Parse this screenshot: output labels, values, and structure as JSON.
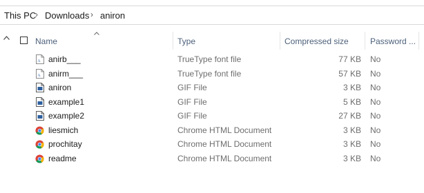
{
  "breadcrumb": {
    "items": [
      "This PC",
      "Downloads",
      "aniron"
    ]
  },
  "columns": {
    "name": "Name",
    "type": "Type",
    "compressed_size": "Compressed size",
    "password": "Password ..."
  },
  "files": [
    {
      "name": "anirb___",
      "type": "TrueType font file",
      "size": "77 KB",
      "password": "No",
      "icon": "font-file-icon"
    },
    {
      "name": "anirm___",
      "type": "TrueType font file",
      "size": "57 KB",
      "password": "No",
      "icon": "font-file-icon"
    },
    {
      "name": "aniron",
      "type": "GIF File",
      "size": "3 KB",
      "password": "No",
      "icon": "gif-file-icon"
    },
    {
      "name": "example1",
      "type": "GIF File",
      "size": "5 KB",
      "password": "No",
      "icon": "gif-file-icon"
    },
    {
      "name": "example2",
      "type": "GIF File",
      "size": "27 KB",
      "password": "No",
      "icon": "gif-file-icon"
    },
    {
      "name": "liesmich",
      "type": "Chrome HTML Document",
      "size": "3 KB",
      "password": "No",
      "icon": "chrome-icon"
    },
    {
      "name": "prochitay",
      "type": "Chrome HTML Document",
      "size": "3 KB",
      "password": "No",
      "icon": "chrome-icon"
    },
    {
      "name": "readme",
      "type": "Chrome HTML Document",
      "size": "3 KB",
      "password": "No",
      "icon": "chrome-icon"
    }
  ]
}
